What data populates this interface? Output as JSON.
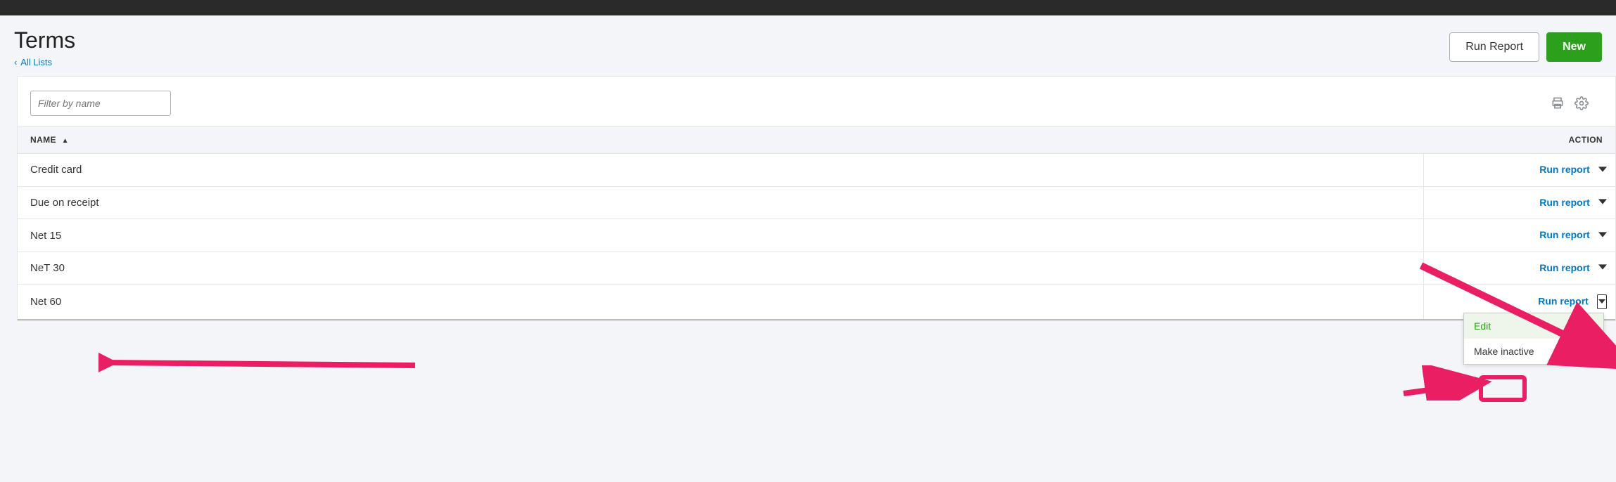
{
  "header": {
    "title": "Terms",
    "breadcrumb_label": "All Lists",
    "run_report_label": "Run Report",
    "new_label": "New"
  },
  "filter": {
    "placeholder": "Filter by name"
  },
  "table": {
    "col_name": "NAME",
    "col_action": "ACTION",
    "rows": [
      {
        "name": "Credit card",
        "action": "Run report"
      },
      {
        "name": "Due on receipt",
        "action": "Run report"
      },
      {
        "name": "Net 15",
        "action": "Run report"
      },
      {
        "name": "NeT 30",
        "action": "Run report"
      },
      {
        "name": "Net 60",
        "action": "Run report"
      }
    ]
  },
  "dropdown": {
    "edit": "Edit",
    "make_inactive": "Make inactive"
  }
}
